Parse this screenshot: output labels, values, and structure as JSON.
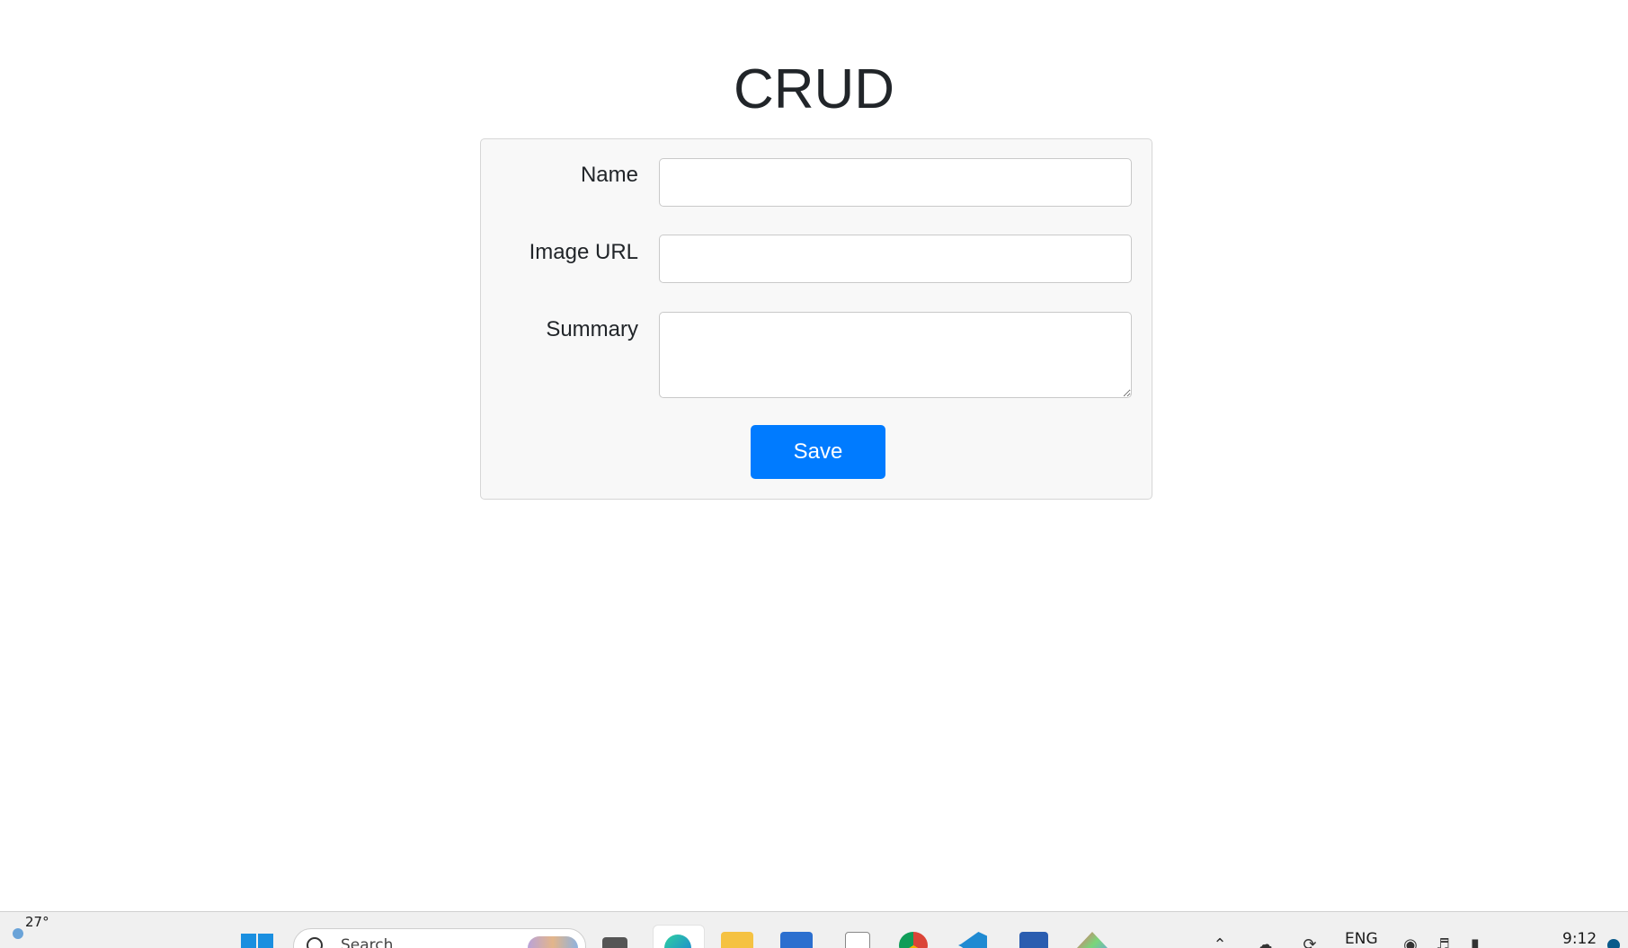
{
  "page": {
    "title": "CRUD"
  },
  "form": {
    "fields": [
      {
        "label": "Name",
        "value": "",
        "placeholder": ""
      },
      {
        "label": "Image URL",
        "value": "",
        "placeholder": ""
      },
      {
        "label": "Summary",
        "value": "",
        "placeholder": ""
      }
    ],
    "save_label": "Save"
  },
  "taskbar": {
    "weather_temp": "27°",
    "search_placeholder": "Search",
    "language": "ENG",
    "time": "9:12",
    "pinned_apps": [
      "task-view-icon",
      "edge-browser-icon",
      "file-explorer-icon",
      "microsoft-store-icon",
      "notepad-icon",
      "chrome-icon",
      "vscode-icon",
      "photos-icon",
      "paint-icon"
    ]
  },
  "colors": {
    "primary": "#007bff",
    "card_background": "#f8f8f8",
    "text": "#212529"
  }
}
